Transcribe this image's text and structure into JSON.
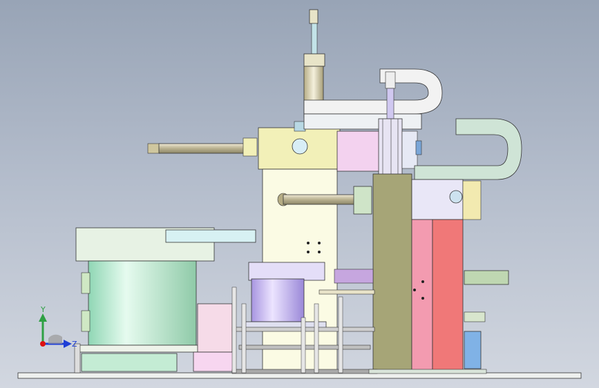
{
  "viewport": {
    "background_top": "#98a4b6",
    "background_bottom": "#d2d7e0"
  },
  "triad": {
    "y_label": "Y",
    "z_label": "Z",
    "y_color": "#2ea043",
    "z_color": "#1f3fd6",
    "x_color": "#d11"
  },
  "palette": {
    "green_bowl": "#b8ead0",
    "lavender_bowl": "#c9b8f0",
    "yellow_frame": "#f2f0b8",
    "pink_block": "#f39bb0",
    "salmon_block": "#f07878",
    "olive_block": "#a6a577",
    "mint_arc": "#cfe4d6",
    "cylinder": "#cdc6a8"
  }
}
